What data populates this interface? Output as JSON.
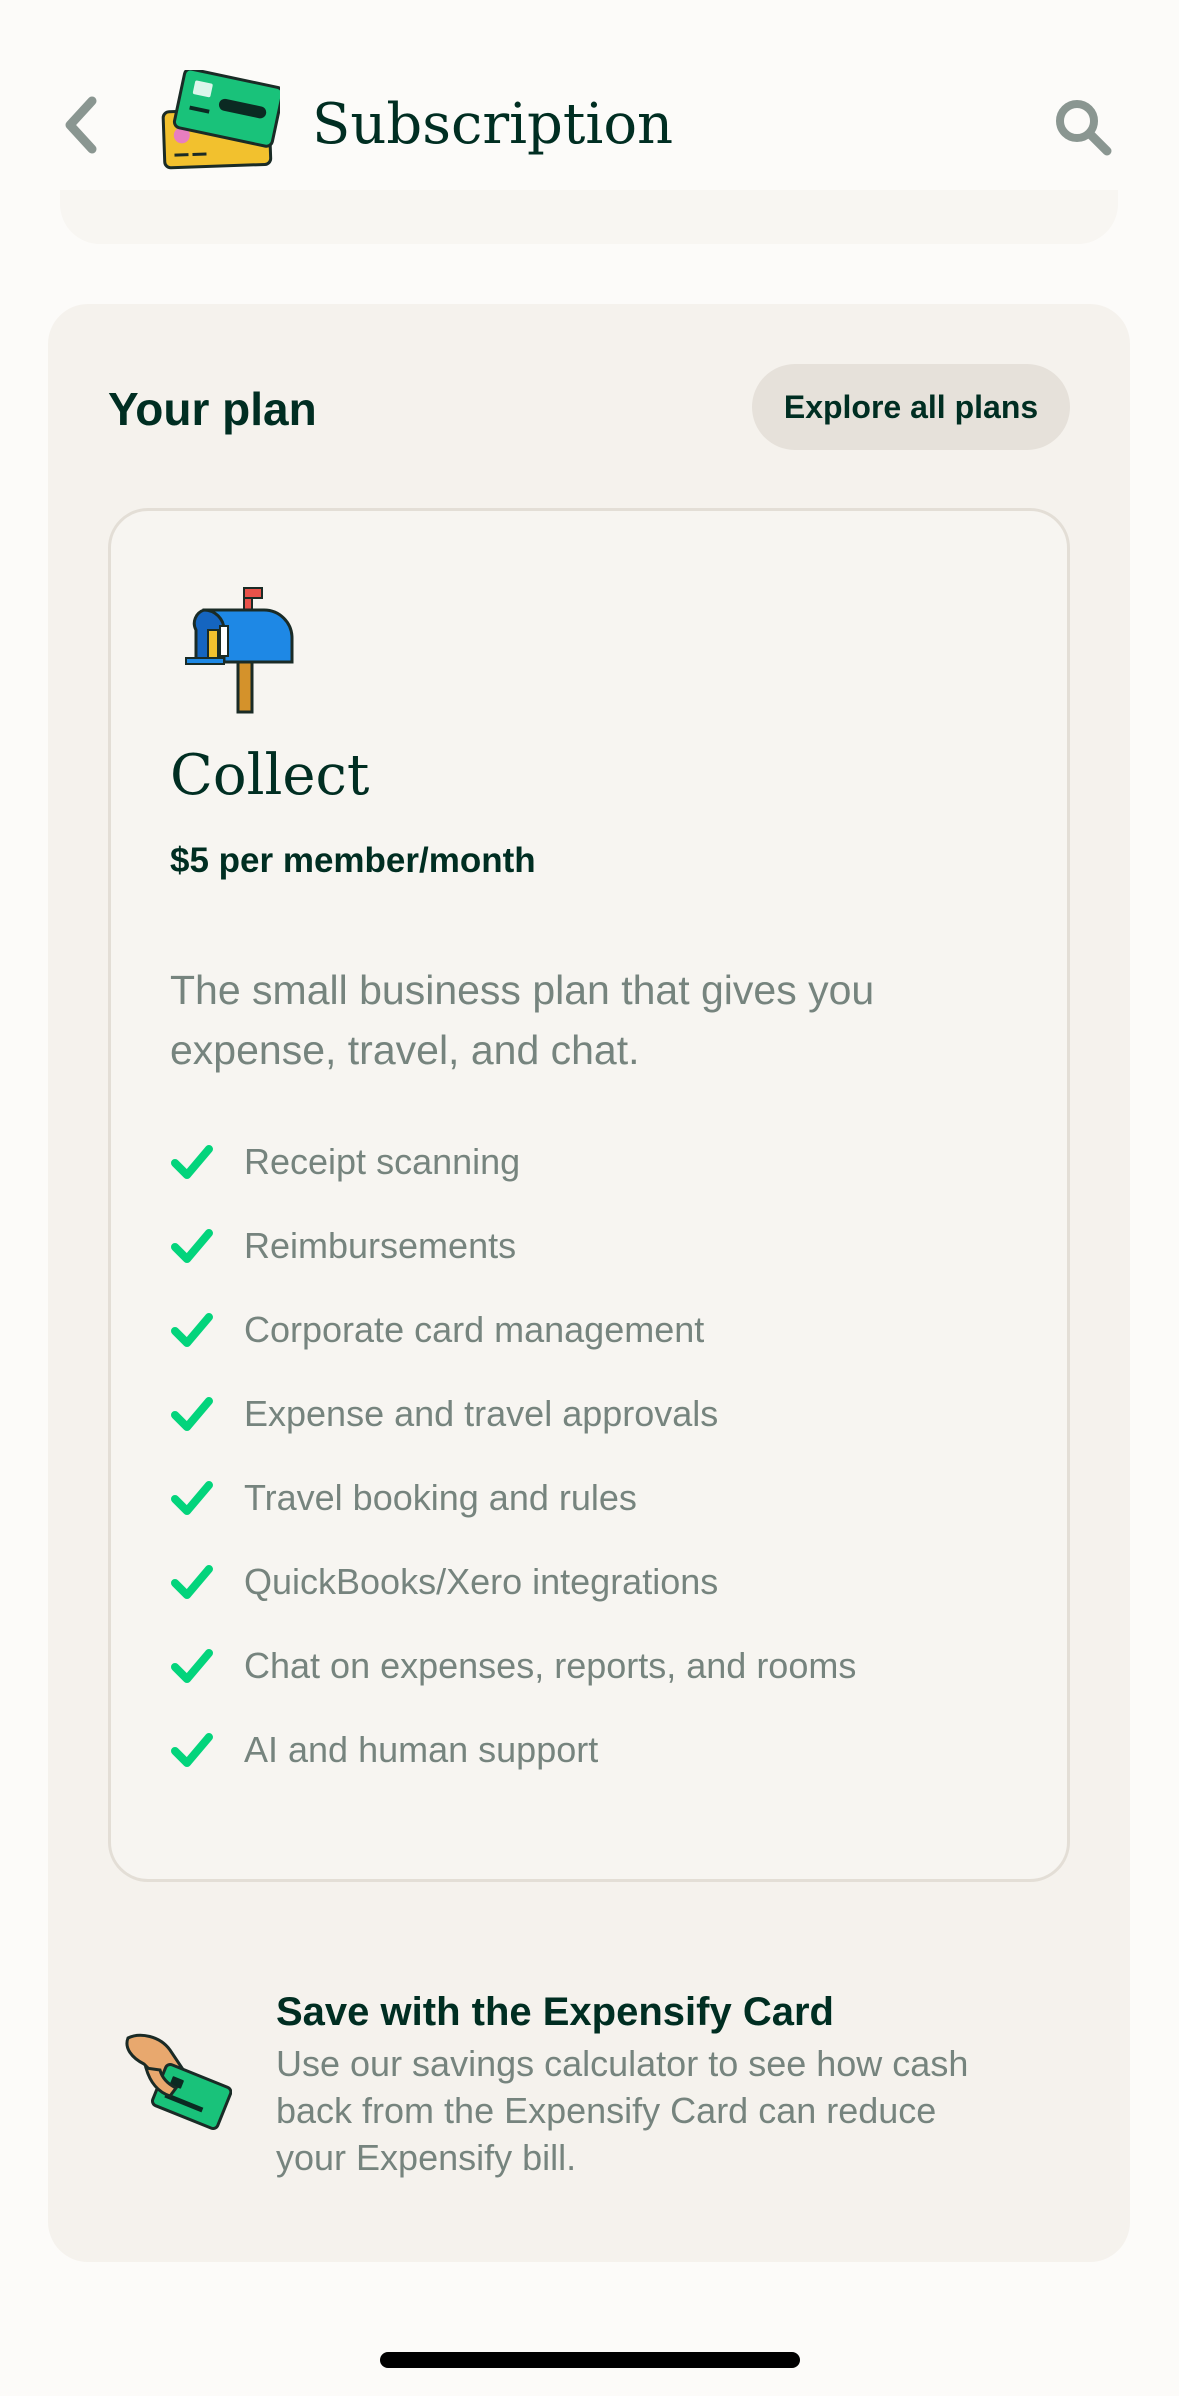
{
  "header": {
    "title": "Subscription",
    "back_icon": "chevron-left-icon",
    "search_icon": "search-icon",
    "header_icon": "credit-cards-icon"
  },
  "plan_section": {
    "title": "Your plan",
    "explore_button": "Explore all plans",
    "plan": {
      "icon": "mailbox-icon",
      "name": "Collect",
      "price": "$5 per member/month",
      "description": "The small business plan that gives you expense, travel, and chat.",
      "features": [
        "Receipt scanning",
        "Reimbursements",
        "Corporate card management",
        "Expense and travel approvals",
        "Travel booking and rules",
        "QuickBooks/Xero integrations",
        "Chat on expenses, reports, and rooms",
        "AI and human support"
      ]
    },
    "promo": {
      "icon": "hand-holding-card-icon",
      "title": "Save with the Expensify Card",
      "body": "Use our savings calculator to see how cash back from the Expensify Card can reduce your Expensify bill."
    }
  },
  "colors": {
    "background": "#FCFBF9",
    "section": "#F5F2ED",
    "text_dark": "#002E22",
    "text_muted": "#76847E",
    "check_green": "#03D47C",
    "button": "#E6E1DA"
  }
}
